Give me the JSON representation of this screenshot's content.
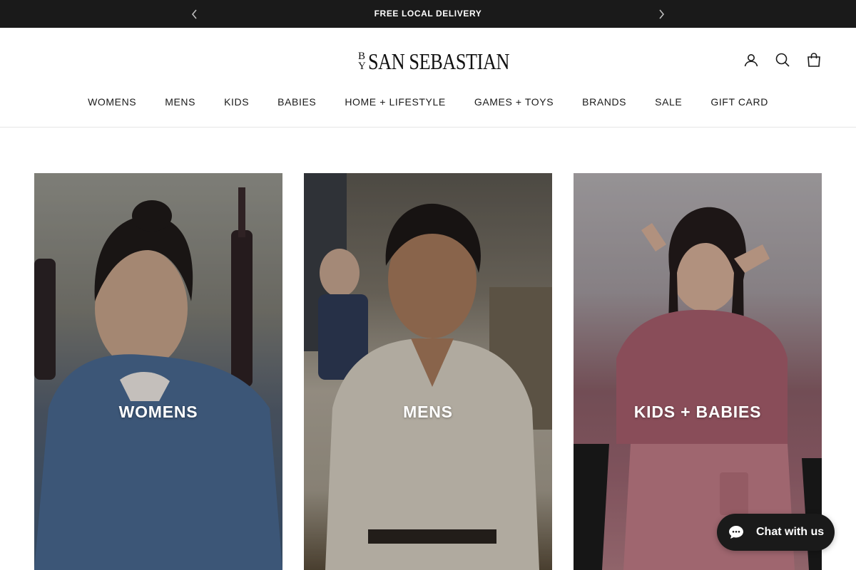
{
  "announcement": {
    "text": "FREE LOCAL DELIVERY",
    "prev_icon": "chevron-left-icon",
    "next_icon": "chevron-right-icon"
  },
  "header": {
    "logo": {
      "prefix_b": "B",
      "prefix_y": "Y",
      "name": "SAN SEBASTIAN"
    },
    "icons": [
      "account-icon",
      "search-icon",
      "cart-bag-icon"
    ]
  },
  "nav": {
    "items": [
      {
        "label": "WOMENS"
      },
      {
        "label": "MENS"
      },
      {
        "label": "KIDS"
      },
      {
        "label": "BABIES"
      },
      {
        "label": "HOME + LIFESTYLE"
      },
      {
        "label": "GAMES + TOYS"
      },
      {
        "label": "BRANDS"
      },
      {
        "label": "SALE"
      },
      {
        "label": "GIFT CARD"
      }
    ]
  },
  "categories": [
    {
      "label": "WOMENS"
    },
    {
      "label": "MENS"
    },
    {
      "label": "KIDS + BABIES"
    }
  ],
  "chat": {
    "label": "Chat with us",
    "icon": "chat-bubble-icon"
  },
  "colors": {
    "announce_bg": "#1a1a1a",
    "text": "#1a1a1a",
    "chat_bg": "#1a1a1a"
  }
}
